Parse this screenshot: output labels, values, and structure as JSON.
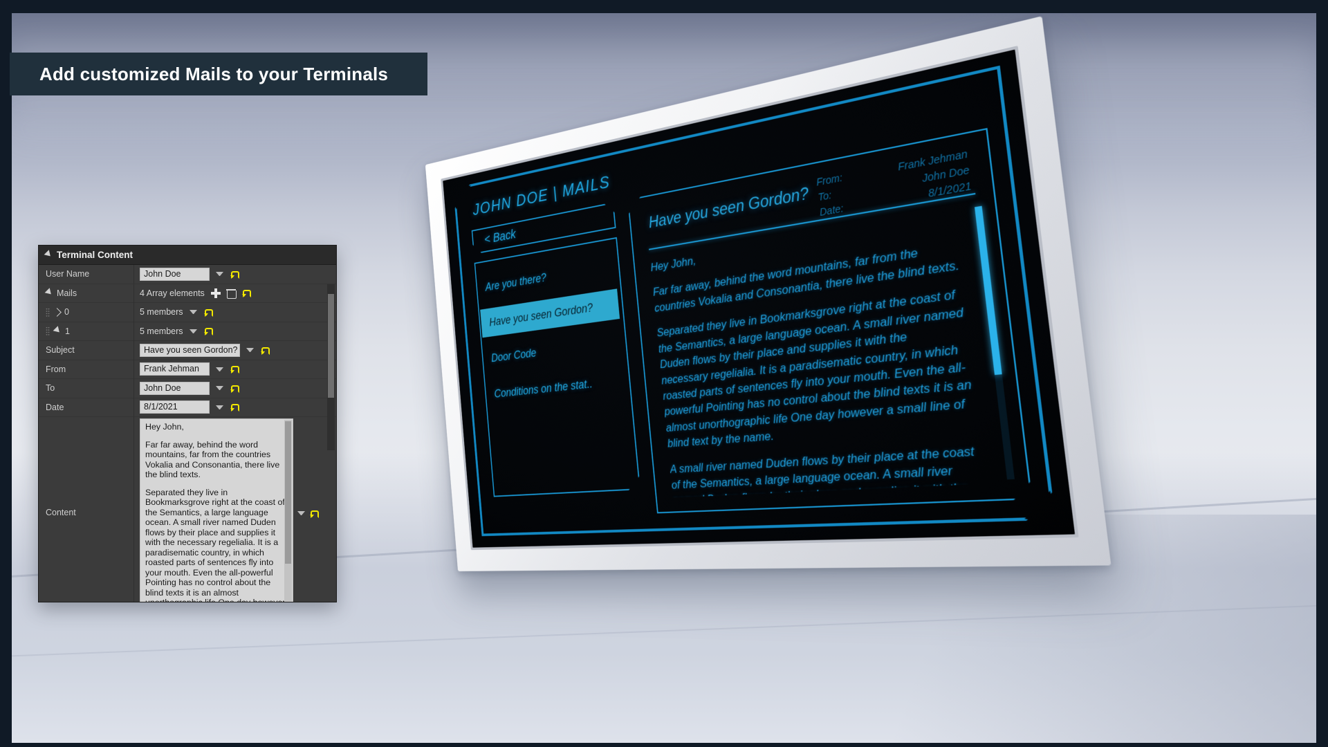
{
  "banner": {
    "text": "Add customized Mails to your Terminals"
  },
  "terminal": {
    "title": "JOHN DOE | MAILS",
    "back_button": "< Back",
    "mail_list": [
      {
        "label": "Are you there?",
        "selected": false
      },
      {
        "label": "Have you seen Gordon?",
        "selected": true
      },
      {
        "label": "Door Code",
        "selected": false
      },
      {
        "label": "Conditions on the stat..",
        "selected": false
      }
    ],
    "open_mail": {
      "subject": "Have you seen Gordon?",
      "meta": {
        "from_label": "From:",
        "from_value": "Frank Jehman",
        "to_label": "To:",
        "to_value": "John Doe",
        "date_label": "Date:",
        "date_value": "8/1/2021"
      },
      "body_paragraphs": [
        "Hey John,",
        "Far far away, behind the word mountains, far from the countries Vokalia and Consonantia, there live the blind texts.",
        "Separated they live in Bookmarksgrove right at the coast of the Semantics, a large language ocean. A small river named Duden flows by their place and supplies it with the necessary regelialia. It is a paradisematic country, in which roasted parts of sentences fly into your mouth. Even the all-powerful Pointing has no control about the blind texts it is an almost unorthographic life One day however a small line of blind text by the name.",
        "A small river named Duden flows by their place at the coast of the Semantics, a large language ocean. A small river named Duden flows by their place and supplies it with the necessary regelialia."
      ]
    }
  },
  "details_panel": {
    "header_title": "Terminal Content",
    "rows": {
      "user_name": {
        "label": "User Name",
        "value": "John Doe"
      },
      "mails": {
        "label": "Mails",
        "value": "4 Array elements"
      },
      "element_0": {
        "label": "0",
        "value": "5 members"
      },
      "element_1": {
        "label": "1",
        "value": "5 members"
      },
      "subject": {
        "label": "Subject",
        "value": "Have you seen Gordon?"
      },
      "from": {
        "label": "From",
        "value": "Frank Jehman"
      },
      "to": {
        "label": "To",
        "value": "John Doe"
      },
      "date": {
        "label": "Date",
        "value": "8/1/2021"
      },
      "content": {
        "label": "Content"
      }
    },
    "content_paragraphs": [
      "Hey John,",
      "Far far away, behind the word mountains, far from the countries Vokalia and Consonantia, there live the blind texts.",
      "Separated they live in Bookmarksgrove right at the coast of the Semantics, a large language ocean. A small river named Duden flows by their place and supplies it with the necessary regelialia. It is a paradisematic country, in which roasted parts of sentences fly into your mouth. Even the all-powerful Pointing has no control about the blind texts it is an almost unorthographic life One day however"
    ],
    "icons": {
      "add": "plus-icon",
      "delete": "trash-icon",
      "reset": "reset-arrow-icon",
      "dropdown": "chevron-down-icon"
    }
  },
  "colors": {
    "accent_cyan": "#1fa8e2",
    "selection_cyan": "#2ea9cf",
    "panel_bg": "#3b3b3b",
    "banner_bg": "#20303c",
    "reset_yellow": "#f2e800"
  }
}
